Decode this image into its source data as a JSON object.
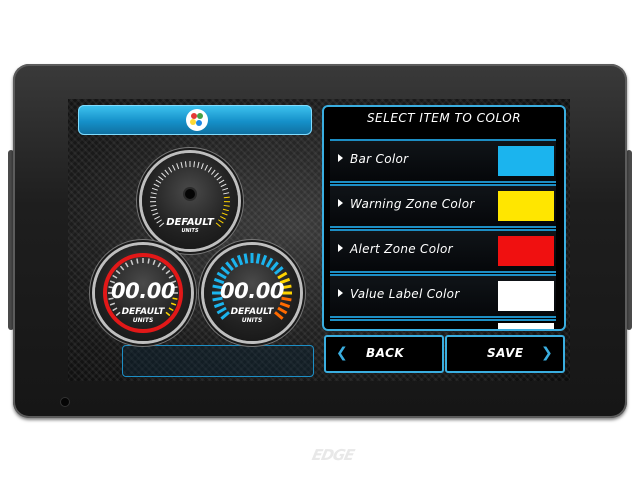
{
  "device": {
    "brand": "EDGE"
  },
  "screen": {
    "gauges": [
      {
        "id": "top",
        "label": "DEFAULT",
        "units": "UNITS",
        "value": ""
      },
      {
        "id": "left",
        "label": "DEFAULT",
        "units": "UNITS",
        "value": "00.00"
      },
      {
        "id": "right",
        "label": "DEFAULT",
        "units": "UNITS",
        "value": "00.00"
      }
    ]
  },
  "panel": {
    "title": "SELECT ITEM TO COLOR",
    "items": [
      {
        "label": "Bar Color",
        "color": "#1bb4ee"
      },
      {
        "label": "Warning Zone Color",
        "color": "#ffe600"
      },
      {
        "label": "Alert Zone Color",
        "color": "#f01010"
      },
      {
        "label": "Value Label Color",
        "color": "#ffffff"
      }
    ]
  },
  "buttons": {
    "back": "BACK",
    "save": "SAVE"
  },
  "colors": {
    "accent": "#1d8ec4"
  }
}
